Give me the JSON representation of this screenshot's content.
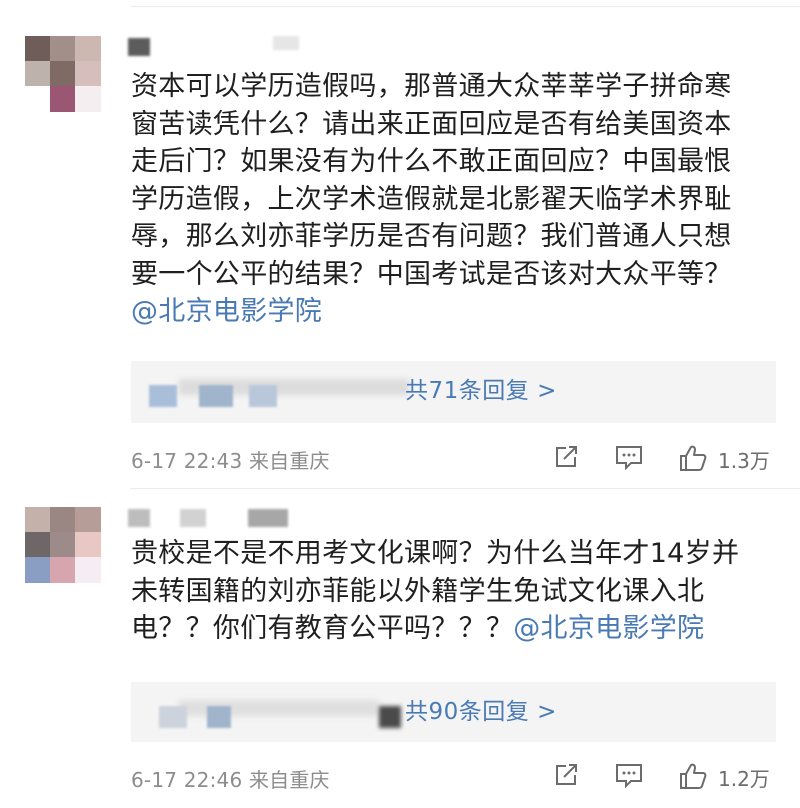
{
  "comments": [
    {
      "text": "资本可以学历造假吗，那普通大众莘莘学子拼命寒窗苦读凭什么？请出来正面回应是否有给美国资本走后门？如果没有为什么不敢正面回应？中国最恨学历造假，上次学术造假就是北影翟天临学术界耻辱，那么刘亦菲学历是否有问题？我们普通人只想要一个公平的结果？中国考试是否该对大众平等？",
      "lines": [
        "资本可以学历造假吗，那普通大众莘莘学子拼命寒",
        "窗苦读凭什么？请出来正面回应是否有给美国资本",
        "走后门？如果没有为什么不敢正面回应？中国最恨",
        "学历造假，上次学术造假就是北影翟天临学术界耻",
        "辱，那么刘亦菲学历是否有问题？我们普通人只想",
        "要一个公平的结果？中国考试是否该对大众平等？"
      ],
      "mention": "@北京电影学院",
      "reply_link": "共71条回复 >",
      "time": "6-17 22:43",
      "location": "来自重庆",
      "likes": "1.3万"
    },
    {
      "lines": [
        "贵校是不是不用考文化课啊？为什么当年才14岁并",
        "未转国籍的刘亦菲能以外籍学生免试文化课入北",
        "电？？你们有教育公平吗？？？"
      ],
      "mention": "@北京电影学院",
      "reply_link": "共90条回复 >",
      "time": "6-17 22:46",
      "location": "来自重庆",
      "likes": "1.2万"
    }
  ],
  "icons": {
    "share": "share-icon",
    "comment": "comment-icon",
    "like": "thumbs-up-icon"
  },
  "colors": {
    "link": "#4a7ab4",
    "meta": "#8d8d8d",
    "reply_bg": "#f4f4f4"
  }
}
